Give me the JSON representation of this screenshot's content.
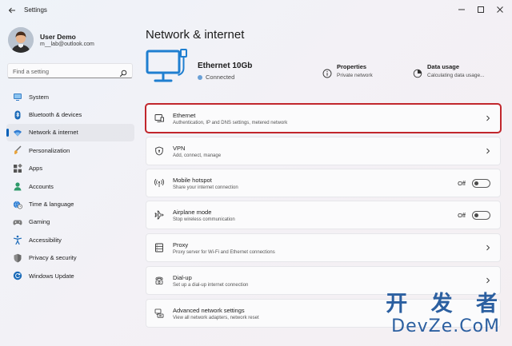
{
  "window": {
    "title": "Settings"
  },
  "user": {
    "name": "User Demo",
    "email": "m__lab@outlook.com"
  },
  "search": {
    "placeholder": "Find a setting"
  },
  "sidebar": {
    "items": [
      {
        "label": "System",
        "icon": "monitor-icon"
      },
      {
        "label": "Bluetooth & devices",
        "icon": "bluetooth-icon"
      },
      {
        "label": "Network & internet",
        "icon": "wifi-icon",
        "active": true
      },
      {
        "label": "Personalization",
        "icon": "brush-icon"
      },
      {
        "label": "Apps",
        "icon": "apps-icon"
      },
      {
        "label": "Accounts",
        "icon": "person-icon"
      },
      {
        "label": "Time & language",
        "icon": "globe-clock-icon"
      },
      {
        "label": "Gaming",
        "icon": "gamepad-icon"
      },
      {
        "label": "Accessibility",
        "icon": "accessibility-icon"
      },
      {
        "label": "Privacy & security",
        "icon": "shield-icon"
      },
      {
        "label": "Windows Update",
        "icon": "update-icon"
      }
    ]
  },
  "main": {
    "title": "Network & internet",
    "connection": {
      "name": "Ethernet 10Gb",
      "status": "Connected"
    },
    "properties": {
      "title": "Properties",
      "subtitle": "Private network"
    },
    "data_usage": {
      "title": "Data usage",
      "subtitle": "Calculating data usage..."
    },
    "cards": [
      {
        "title": "Ethernet",
        "subtitle": "Authentication, IP and DNS settings, metered network"
      },
      {
        "title": "VPN",
        "subtitle": "Add, connect, manage"
      },
      {
        "title": "Mobile hotspot",
        "subtitle": "Share your internet connection",
        "toggle": "Off"
      },
      {
        "title": "Airplane mode",
        "subtitle": "Stop wireless communication",
        "toggle": "Off"
      },
      {
        "title": "Proxy",
        "subtitle": "Proxy server for Wi-Fi and Ethernet connections"
      },
      {
        "title": "Dial-up",
        "subtitle": "Set up a dial-up internet connection"
      },
      {
        "title": "Advanced network settings",
        "subtitle": "View all network adapters, network reset"
      }
    ]
  },
  "watermark": {
    "top": "开 发 者",
    "bottom": "DevZe.CoM"
  },
  "colors": {
    "accent": "#005fb8",
    "highlight": "#c1262c",
    "watermark": "#2b5fa0"
  }
}
